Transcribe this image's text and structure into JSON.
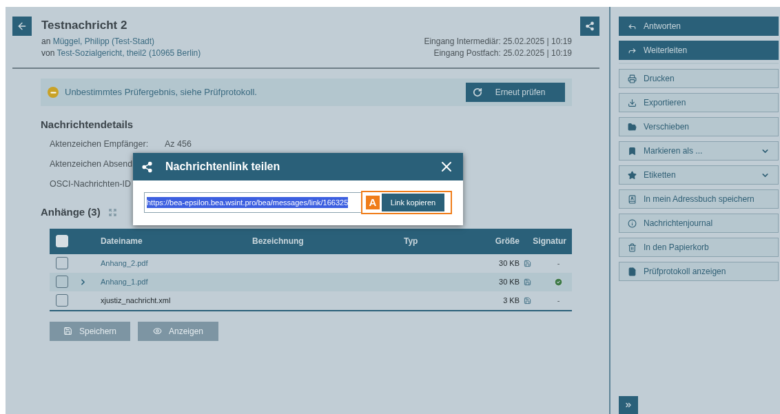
{
  "header": {
    "title": "Testnachricht 2",
    "recipient_prefix": "an",
    "recipient": "Müggel, Philipp (Test-Stadt)",
    "sender_prefix": "von",
    "sender": "Test-Sozialgericht, theil2 (10965 Berlin)",
    "dates": [
      "Eingang Intermediär: 25.02.2025 | 10:19",
      "Eingang Postfach: 25.02.2025 | 10:19"
    ]
  },
  "notice": {
    "text": "Unbestimmtes Prüfergebnis, siehe Prüfprotokoll.",
    "button": "Erneut prüfen"
  },
  "details": {
    "heading": "Nachrichtendetails",
    "rows": [
      {
        "label": "Aktenzeichen Empfänger:",
        "value": "Az 456"
      },
      {
        "label": "Aktenzeichen Absend"
      },
      {
        "label": "OSCI-Nachrichten-ID"
      }
    ]
  },
  "attachments": {
    "heading": "Anhänge (3)",
    "columns": [
      "Dateiname",
      "Bezeichnung",
      "Typ",
      "Größe",
      "Signatur"
    ],
    "all_checked": false,
    "rows": [
      {
        "checked": false,
        "selected": false,
        "expandable": false,
        "kind": "link",
        "name": "Anhang_2.pdf",
        "size": "30 KB",
        "signature": {
          "kind": "text",
          "text": "-"
        }
      },
      {
        "checked": false,
        "selected": true,
        "expandable": true,
        "kind": "link",
        "name": "Anhang_1.pdf",
        "size": "30 KB",
        "signature": {
          "kind": "valid"
        }
      },
      {
        "checked": false,
        "selected": false,
        "expandable": false,
        "kind": "plain",
        "name": "xjustiz_nachricht.xml",
        "size": "3 KB",
        "signature": {
          "kind": "text",
          "text": "-"
        }
      }
    ],
    "buttons": [
      {
        "label": "Speichern",
        "disabled": true
      },
      {
        "label": "Anzeigen",
        "disabled": true
      }
    ]
  },
  "sidebar": {
    "actions": [
      {
        "label": "Antworten",
        "kind": "primary",
        "dropdown": false
      },
      {
        "label": "Weiterleiten",
        "kind": "primary",
        "dropdown": false
      },
      {
        "label": "Drucken",
        "kind": "secondary",
        "dropdown": false
      },
      {
        "label": "Exportieren",
        "kind": "secondary",
        "dropdown": false
      },
      {
        "label": "Verschieben",
        "kind": "secondary",
        "dropdown": false
      },
      {
        "label": "Markieren als ...",
        "kind": "secondary",
        "dropdown": true
      },
      {
        "label": "Etiketten",
        "kind": "secondary",
        "dropdown": true
      },
      {
        "label": "In mein Adressbuch speichern",
        "kind": "secondary",
        "dropdown": false
      },
      {
        "label": "Nachrichtenjournal",
        "kind": "secondary",
        "dropdown": false
      },
      {
        "label": "In den Papierkorb",
        "kind": "secondary",
        "dropdown": false
      },
      {
        "label": "Prüfprotokoll anzeigen",
        "kind": "secondary",
        "dropdown": false
      }
    ]
  },
  "modal": {
    "title": "Nachrichtenlink teilen",
    "url": "https://bea-epsilon.bea.wsint.pro/bea/messages/link/166325",
    "marker": "A",
    "button": "Link kopieren"
  }
}
